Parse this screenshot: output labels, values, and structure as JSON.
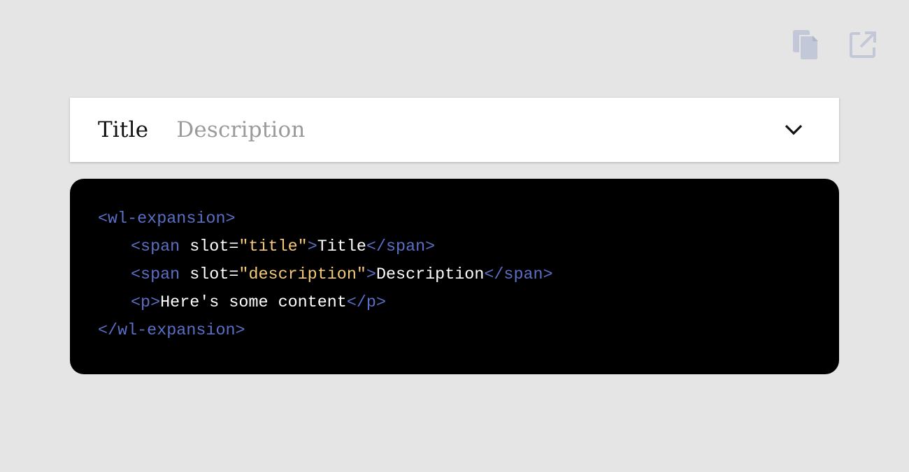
{
  "toolbar": {
    "copy_icon": "copy-icon",
    "open_icon": "open-in-new-icon",
    "icon_color": "#c2c8d8"
  },
  "expansion": {
    "title": "Title",
    "description": "Description",
    "chevron_icon": "chevron-down-icon"
  },
  "code": {
    "line1": {
      "open": "<wl-expansion>"
    },
    "line2": {
      "open": "<span",
      "attr": " slot=",
      "value": "\"title\"",
      "close_bracket": ">",
      "text": "Title",
      "end_tag": "</span>"
    },
    "line3": {
      "open": "<span",
      "attr": " slot=",
      "value": "\"description\"",
      "close_bracket": ">",
      "text": "Description",
      "end_tag": "</span>"
    },
    "line4": {
      "open": "<p>",
      "text": "Here's some content",
      "end_tag": "</p>"
    },
    "line5": {
      "close": "</wl-expansion>"
    }
  },
  "colors": {
    "background": "#e5e5e5",
    "tag": "#5b6fc6",
    "string": "#f5c97a",
    "code_bg": "#000000"
  }
}
